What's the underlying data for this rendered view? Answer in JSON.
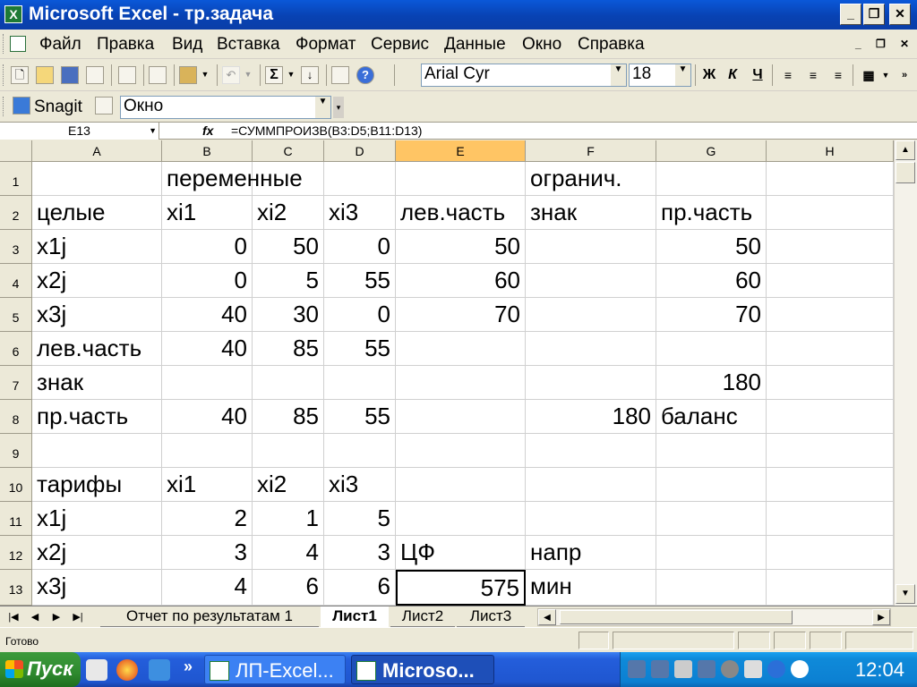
{
  "app": {
    "title": "Microsoft Excel - тр.задача",
    "icon": "excel-icon",
    "window_controls": {
      "minimize": "_",
      "restore": "❐",
      "close": "✕"
    }
  },
  "menubar": {
    "items": [
      "Файл",
      "Правка",
      "Вид",
      "Вставка",
      "Формат",
      "Сервис",
      "Данные",
      "Окно",
      "Справка"
    ],
    "doc_controls": {
      "minimize": "_",
      "restore": "❐",
      "close": "✕"
    }
  },
  "toolbar": {
    "font_name": "Arial Cyr",
    "font_size": "18",
    "bold": "Ж",
    "italic": "К",
    "underline": "Ч",
    "sigma": "Σ"
  },
  "snagit_bar": {
    "label": "Snagit",
    "window_select": "Окно"
  },
  "formula_bar": {
    "name_box": "E13",
    "fx": "fx",
    "formula": "=СУММПРОИЗВ(B3:D5;B11:D13)"
  },
  "grid": {
    "columns": [
      "A",
      "B",
      "C",
      "D",
      "E",
      "F",
      "G",
      "H"
    ],
    "selected_column": "E",
    "rows": [
      "1",
      "2",
      "3",
      "4",
      "5",
      "6",
      "7",
      "8",
      "9",
      "10",
      "11",
      "12",
      "13"
    ],
    "active_cell": "E13",
    "cells": {
      "B1": "переменные",
      "F1": "огранич.",
      "A2": "целые",
      "B2": "xi1",
      "C2": "xi2",
      "D2": "xi3",
      "E2": "лев.часть",
      "F2": "знак",
      "G2": "пр.часть",
      "A3": "x1j",
      "B3": "0",
      "C3": "50",
      "D3": "0",
      "E3": "50",
      "G3": "50",
      "A4": "x2j",
      "B4": "0",
      "C4": "5",
      "D4": "55",
      "E4": "60",
      "G4": "60",
      "A5": "x3j",
      "B5": "40",
      "C5": "30",
      "D5": "0",
      "E5": "70",
      "G5": "70",
      "A6": "лев.часть",
      "B6": "40",
      "C6": "85",
      "D6": "55",
      "A7": "знак",
      "G7": "180",
      "A8": "пр.часть",
      "B8": "40",
      "C8": "85",
      "D8": "55",
      "F8": "180",
      "G8": "баланс",
      "A10": "тарифы",
      "B10": "xi1",
      "C10": "xi2",
      "D10": "xi3",
      "A11": "x1j",
      "B11": "2",
      "C11": "1",
      "D11": "5",
      "A12": "x2j",
      "B12": "3",
      "C12": "4",
      "D12": "3",
      "E12": "ЦФ",
      "F12": "напр",
      "A13": "x3j",
      "B13": "4",
      "C13": "6",
      "D13": "6",
      "E13": "575",
      "F13": "мин"
    }
  },
  "sheet_tabs": {
    "tabs": [
      "Отчет по результатам 1",
      "Лист1",
      "Лист2",
      "Лист3"
    ],
    "active": "Лист1"
  },
  "status_bar": {
    "text": "Готово"
  },
  "taskbar": {
    "start_label": "Пуск",
    "more": "»",
    "tasks": [
      "ЛП-Excel...",
      "Microso..."
    ],
    "active_task": "Microso...",
    "clock": "12:04"
  }
}
